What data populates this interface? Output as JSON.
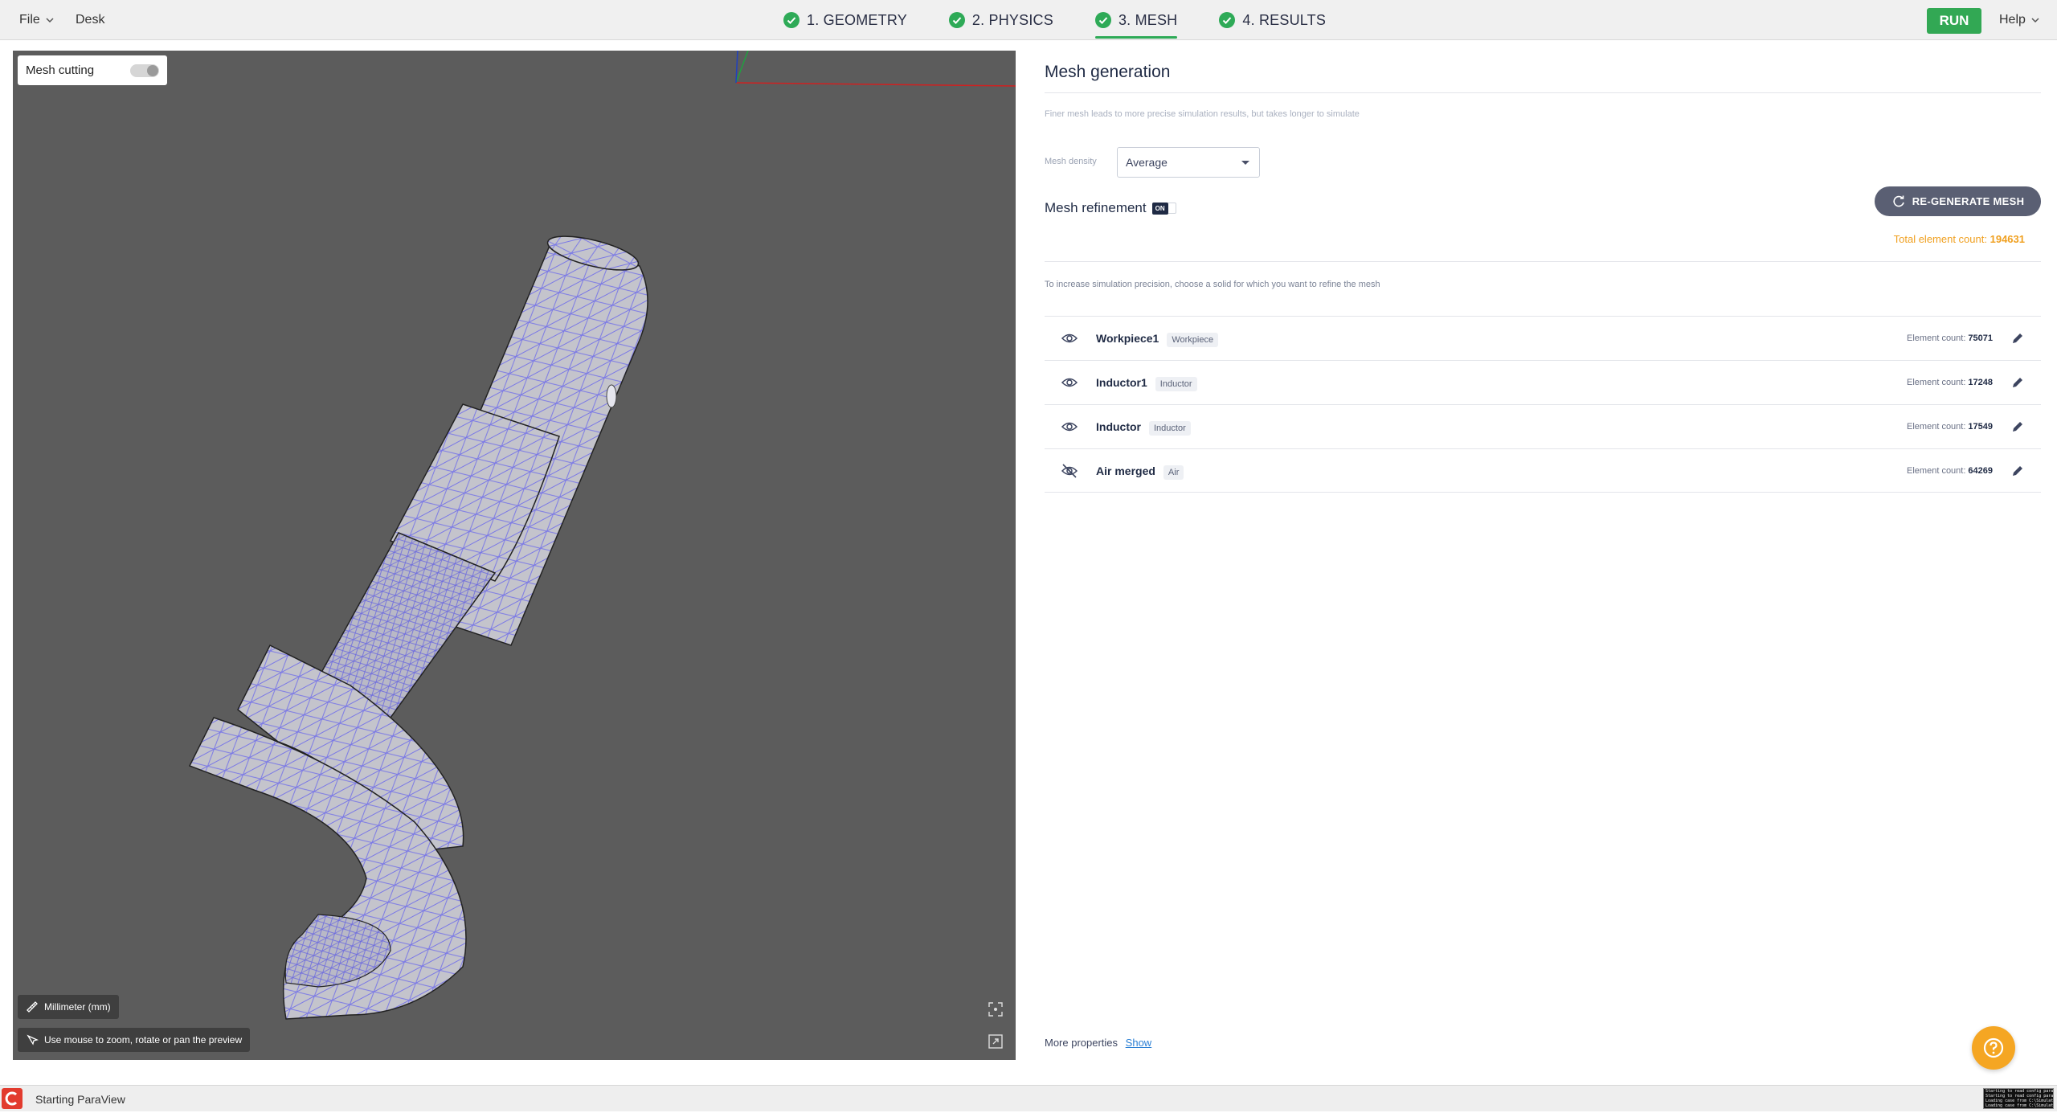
{
  "topbar": {
    "file_label": "File",
    "desk_label": "Desk",
    "steps": [
      {
        "label": "1. GEOMETRY"
      },
      {
        "label": "2. PHYSICS"
      },
      {
        "label": "3. MESH"
      },
      {
        "label": "4. RESULTS"
      }
    ],
    "active_step": "3. MESH",
    "run_label": "RUN",
    "help_label": "Help"
  },
  "viewport": {
    "mesh_cutting_label": "Mesh cutting",
    "mesh_cutting_on": false,
    "unit_label": "Millimeter (mm)",
    "hint_label": "Use mouse to zoom, rotate or pan the preview"
  },
  "panel": {
    "title": "Mesh generation",
    "hint": "Finer mesh leads to more precise simulation results, but takes longer to simulate",
    "density_label": "Mesh density",
    "density_value": "Average",
    "refinement_title": "Mesh refinement",
    "refinement_badge": "ON",
    "regen_label": "RE-GENERATE MESH",
    "total_label": "Total element count:",
    "total_value": "194631",
    "refine_hint": "To increase simulation precision, choose a solid for which you want to refine the mesh",
    "solids": [
      {
        "name": "Workpiece1",
        "tag": "Workpiece",
        "count_label": "Element count:",
        "count": "75071",
        "visible": true
      },
      {
        "name": "Inductor1",
        "tag": "Inductor",
        "count_label": "Element count:",
        "count": "17248",
        "visible": true
      },
      {
        "name": "Inductor",
        "tag": "Inductor",
        "count_label": "Element count:",
        "count": "17549",
        "visible": true
      },
      {
        "name": "Air merged",
        "tag": "Air",
        "count_label": "Element count:",
        "count": "64269",
        "visible": false
      }
    ],
    "more_label": "More properties",
    "show_label": "Show"
  },
  "statusbar": {
    "text": "Starting ParaView",
    "console_lines": [
      "Starting to read config params",
      "Starting to read config params",
      "Loading case from C:\\Simulati",
      "Loading case from C:\\Simulati"
    ]
  },
  "colors": {
    "accent_green": "#32a854",
    "count_orange": "#f0a020",
    "viewport_bg": "#5c5c5c",
    "mesh_line": "#7a78e6",
    "fab_orange": "#f5a623"
  },
  "icons": [
    "check-circle-icon",
    "chevron-down-icon",
    "ruler-icon",
    "mouse-icon",
    "focus-icon",
    "expand-icon",
    "refresh-icon",
    "eye-icon",
    "eye-off-icon",
    "pencil-icon",
    "help-icon"
  ]
}
